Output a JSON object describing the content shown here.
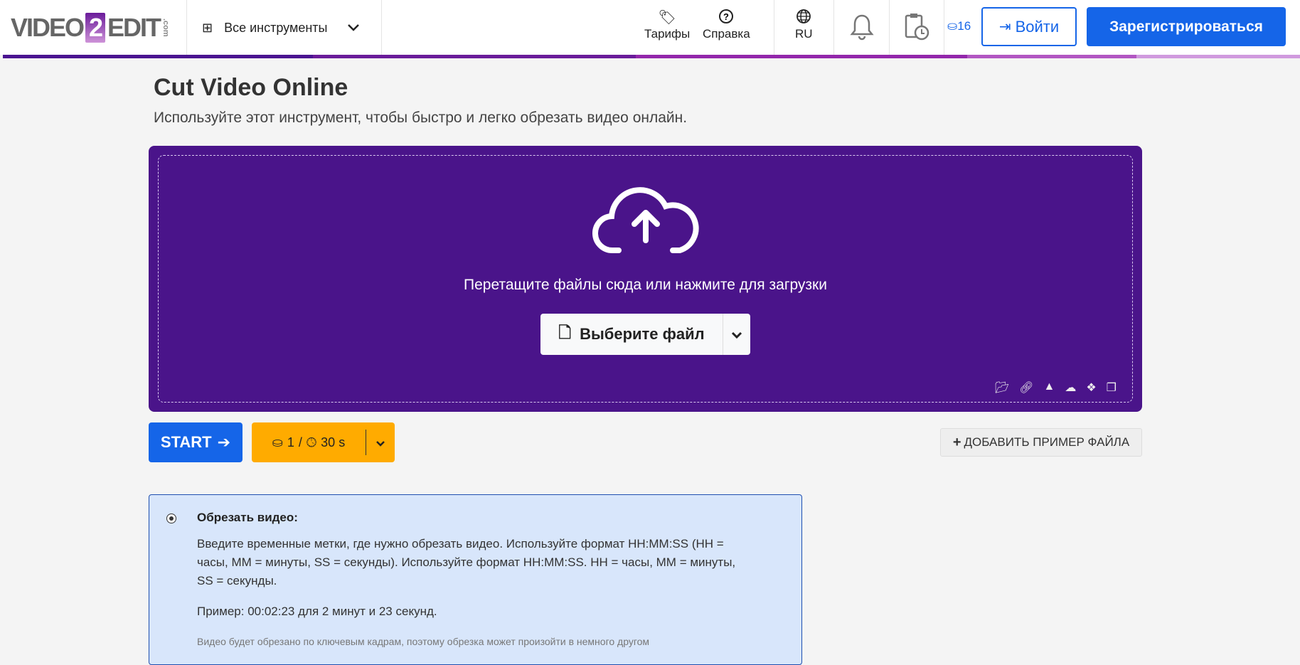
{
  "header": {
    "logo": "VIDEO2EDIT.com",
    "logo_left": "VIDEO",
    "logo_num": "2",
    "logo_right": "EDIT",
    "logo_com": ".com",
    "all_tools": "Все инструменты",
    "pricing": "Тарифы",
    "help": "Справка",
    "lang": "RU",
    "credits": "16",
    "login": "Войти",
    "register": "Зарегистрироваться"
  },
  "page": {
    "title": "Cut Video Online",
    "subtitle": "Используйте этот инструмент, чтобы быстро и легко обрезать видео онлайн."
  },
  "upload": {
    "drop_text": "Перетащите файлы сюда или нажмите для загрузки",
    "choose_file": "Выберите файл",
    "sources": [
      "folder-icon",
      "link-icon",
      "google-drive-icon",
      "onedrive-icon",
      "dropbox-icon",
      "clipboard-icon"
    ]
  },
  "actions": {
    "start": "START",
    "cost_credits": "1",
    "cost_sep": "/",
    "cost_time": "30 s",
    "add_sample": "ДОБАВИТЬ ПРИМЕР ФАЙЛА"
  },
  "info": {
    "title": "Обрезать видео:",
    "text": "Введите временные метки, где нужно обрезать видео. Используйте формат HH:MM:SS (HH = часы, MM = минуты, SS = секунды). Используйте формат HH:MM:SS. HH = часы, MM = минуты, SS = секунды.",
    "example": "Пример: 00:02:23 для 2 минут и 23 секунд.",
    "note": "Видео будет обрезано по ключевым кадрам, поэтому обрезка может произойти в немного другом"
  },
  "colors": {
    "purple": "#4a148a",
    "blue": "#1565e8",
    "orange": "#ffab00"
  }
}
